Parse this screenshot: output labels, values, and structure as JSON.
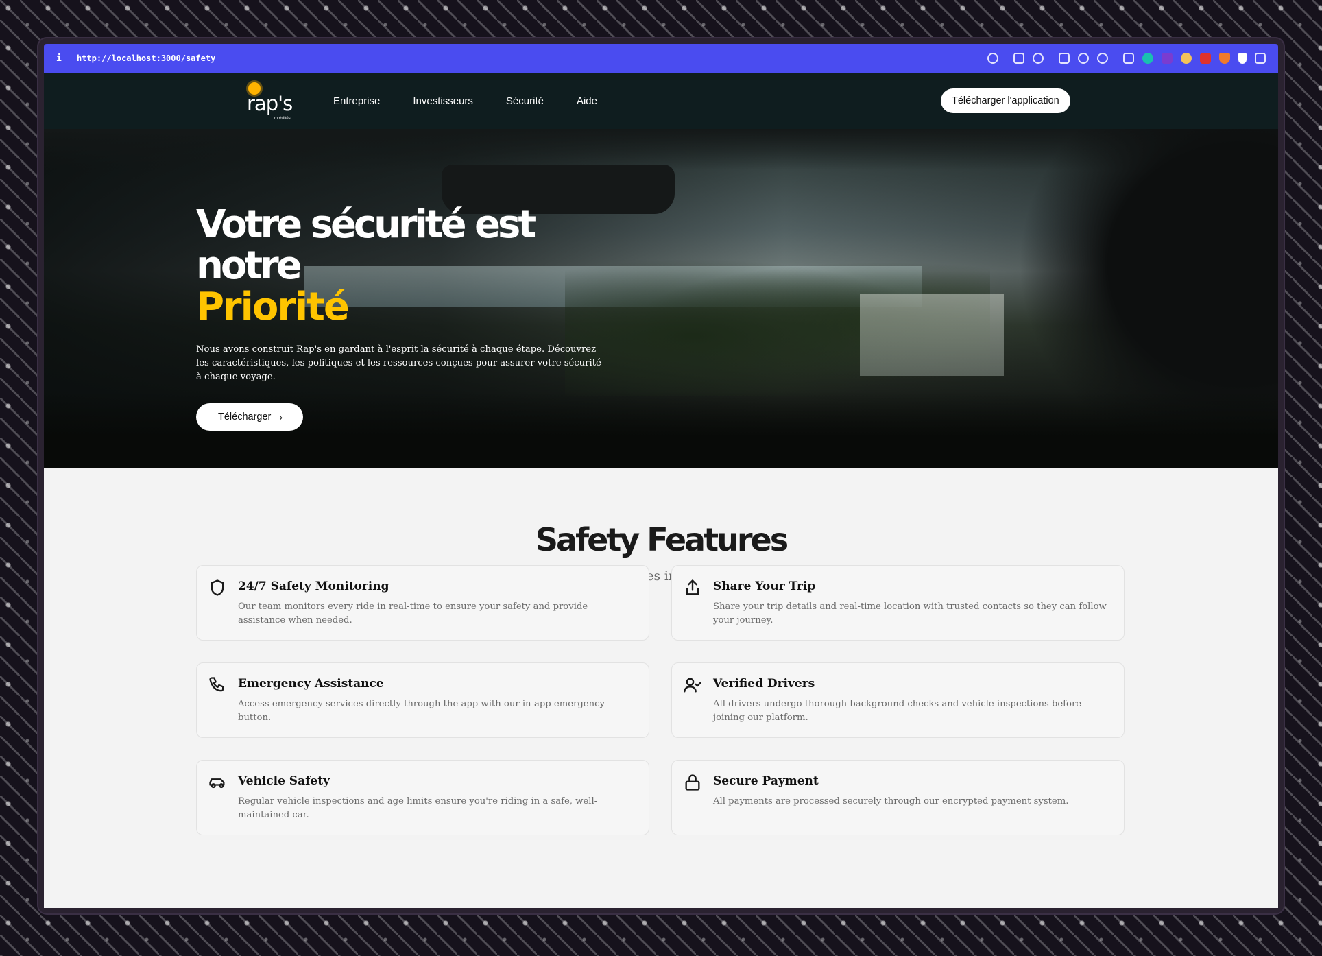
{
  "browser": {
    "info_label": "i",
    "url": "http://localhost:3000/safety"
  },
  "navbar": {
    "logo_text": "rap's",
    "logo_tagline": "mobilités",
    "links": [
      "Entreprise",
      "Investisseurs",
      "Sécurité",
      "Aide"
    ],
    "cta": "Télécharger l'application"
  },
  "hero": {
    "title_line1": "Votre sécurité est notre",
    "title_line2": "Priorité",
    "description": "Nous avons construit Rap's en gardant à l'esprit la sécurité à chaque étape. Découvrez les caractéristiques, les politiques et les ressources conçues pour assurer votre sécurité à chaque voyage.",
    "button": "Télécharger",
    "button_icon": "chevron-right-icon"
  },
  "features": {
    "title": "Safety Features",
    "subtitle": "We've built comprehensive safety features into every aspect of the Rap's experience.",
    "items": [
      {
        "icon": "shield-icon",
        "title": "24/7 Safety Monitoring",
        "text": "Our team monitors every ride in real-time to ensure your safety and provide assistance when needed."
      },
      {
        "icon": "share-icon",
        "title": "Share Your Trip",
        "text": "Share your trip details and real-time location with trusted contacts so they can follow your journey."
      },
      {
        "icon": "phone-icon",
        "title": "Emergency Assistance",
        "text": "Access emergency services directly through the app with our in-app emergency button."
      },
      {
        "icon": "user-check-icon",
        "title": "Verified Drivers",
        "text": "All drivers undergo thorough background checks and vehicle inspections before joining our platform."
      },
      {
        "icon": "car-icon",
        "title": "Vehicle Safety",
        "text": "Regular vehicle inspections and age limits ensure you're riding in a safe, well-maintained car."
      },
      {
        "icon": "lock-icon",
        "title": "Secure Payment",
        "text": "All payments are processed securely through our encrypted payment system."
      }
    ]
  },
  "colors": {
    "urlbar": "#4a4cf0",
    "navbar": "#0f1d1f",
    "accent": "#ffc400",
    "page_bg": "#f3f3f3"
  }
}
